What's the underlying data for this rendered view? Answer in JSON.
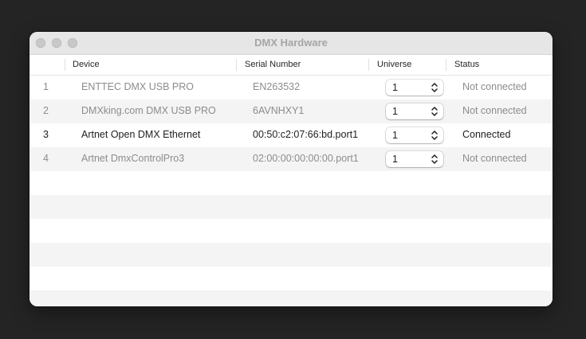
{
  "window": {
    "title": "DMX Hardware"
  },
  "table": {
    "columns": [
      "",
      "Device",
      "Serial Number",
      "Universe",
      "Status"
    ],
    "rows": [
      {
        "index": "1",
        "device": "ENTTEC DMX USB PRO",
        "serial": "EN263532",
        "universe": "1",
        "status": "Not connected",
        "active": false
      },
      {
        "index": "2",
        "device": "DMXking.com DMX USB PRO",
        "serial": "6AVNHXY1",
        "universe": "1",
        "status": "Not connected",
        "active": false
      },
      {
        "index": "3",
        "device": "Artnet Open DMX Ethernet",
        "serial": "00:50:c2:07:66:bd.port1",
        "universe": "1",
        "status": "Connected",
        "active": true
      },
      {
        "index": "4",
        "device": "Artnet DmxControlPro3",
        "serial": "02:00:00:00:00:00.port1",
        "universe": "1",
        "status": "Not connected",
        "active": false
      }
    ]
  },
  "icons": {
    "stepper": "up-down-chevron-icon",
    "window_controls": [
      "close-icon",
      "minimize-icon",
      "zoom-icon"
    ]
  },
  "colors": {
    "background": "#242424",
    "titlebar": "#e6e6e6",
    "row_alt": "#f4f4f4",
    "text_active": "#1e1e1e",
    "text_inactive": "#8c8c8c"
  }
}
